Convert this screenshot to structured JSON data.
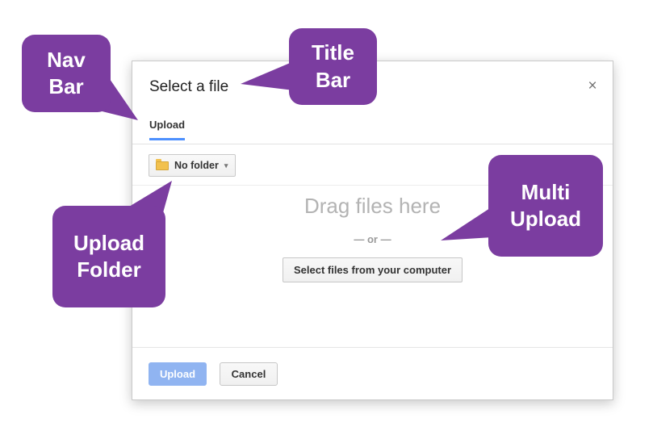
{
  "colors": {
    "accent_purple": "#7b3da0",
    "tab_underline_blue": "#4d90fe",
    "upload_button_blue": "#90b4f1",
    "folder_icon_yellow": "#f2c14e"
  },
  "annotations": {
    "nav_bar": {
      "label": "Nav Bar"
    },
    "title_bar": {
      "label": "Title Bar"
    },
    "upload_folder": {
      "label": "Upload Folder"
    },
    "multi_upload": {
      "label": "Multi Upload"
    }
  },
  "dialog": {
    "title": "Select a file",
    "close_icon": "×",
    "tabs": [
      {
        "label": "Upload",
        "active": true
      }
    ],
    "folder_dropdown": {
      "label": "No folder",
      "caret_icon": "▾"
    },
    "dropzone": {
      "drag_text": "Drag files here",
      "or_text": "— or —",
      "select_button_label": "Select files from your computer"
    },
    "footer": {
      "upload_label": "Upload",
      "cancel_label": "Cancel"
    }
  }
}
